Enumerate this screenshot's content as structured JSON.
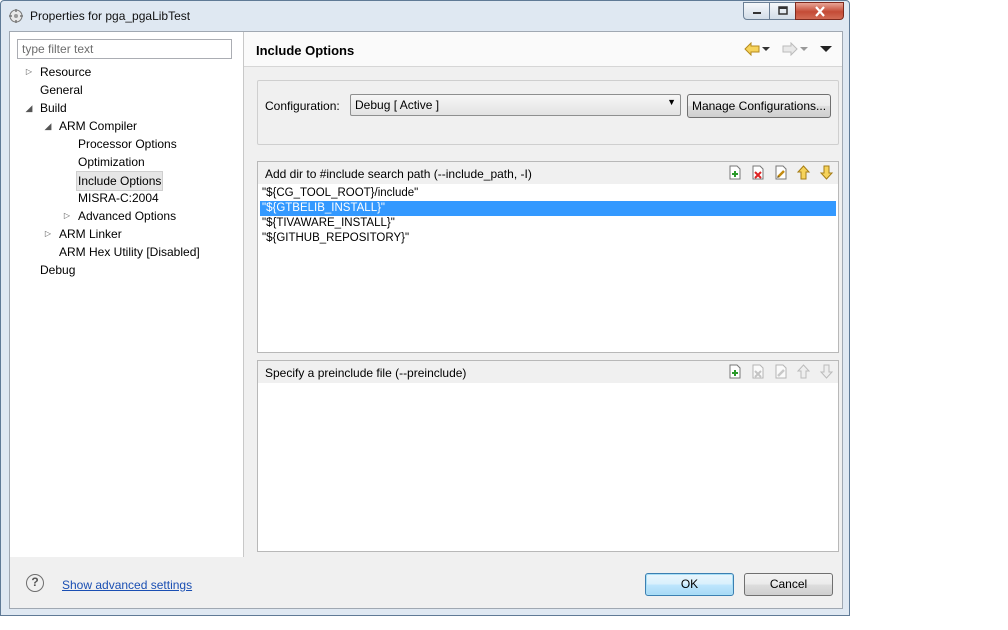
{
  "window": {
    "title": "Properties for pga_pgaLibTest"
  },
  "filter": {
    "placeholder": "type filter text"
  },
  "tree": {
    "resource": "Resource",
    "general": "General",
    "build": "Build",
    "arm_compiler": "ARM Compiler",
    "processor_options": "Processor Options",
    "optimization": "Optimization",
    "include_options": "Include Options",
    "misra": "MISRA-C:2004",
    "advanced_options": "Advanced Options",
    "arm_linker": "ARM Linker",
    "arm_hex_utility": "ARM Hex Utility  [Disabled]",
    "debug": "Debug"
  },
  "page": {
    "title": "Include Options"
  },
  "configuration": {
    "label": "Configuration:",
    "selected": "Debug  [ Active ]",
    "manage_label": "Manage Configurations..."
  },
  "include_paths": {
    "title": "Add dir to #include search path (--include_path, -I)",
    "items": [
      "\"${CG_TOOL_ROOT}/include\"",
      "\"${GTBELIB_INSTALL}\"",
      "\"${TIVAWARE_INSTALL}\"",
      "\"${GITHUB_REPOSITORY}\""
    ],
    "selected_index": 1
  },
  "preinclude": {
    "title": "Specify a preinclude file (--preinclude)"
  },
  "footer": {
    "help_symbol": "?",
    "advanced_link": "Show advanced settings",
    "ok_label": "OK",
    "cancel_label": "Cancel"
  },
  "colors": {
    "selection": "#3399ff",
    "link": "#1a4fb3"
  },
  "icons": {
    "add": "add-icon",
    "delete": "delete-icon",
    "edit": "edit-icon",
    "move_up": "move-up-icon",
    "move_down": "move-down-icon",
    "back": "back-arrow-icon",
    "forward": "forward-arrow-icon",
    "view_menu": "view-menu-icon",
    "help": "help-icon"
  }
}
